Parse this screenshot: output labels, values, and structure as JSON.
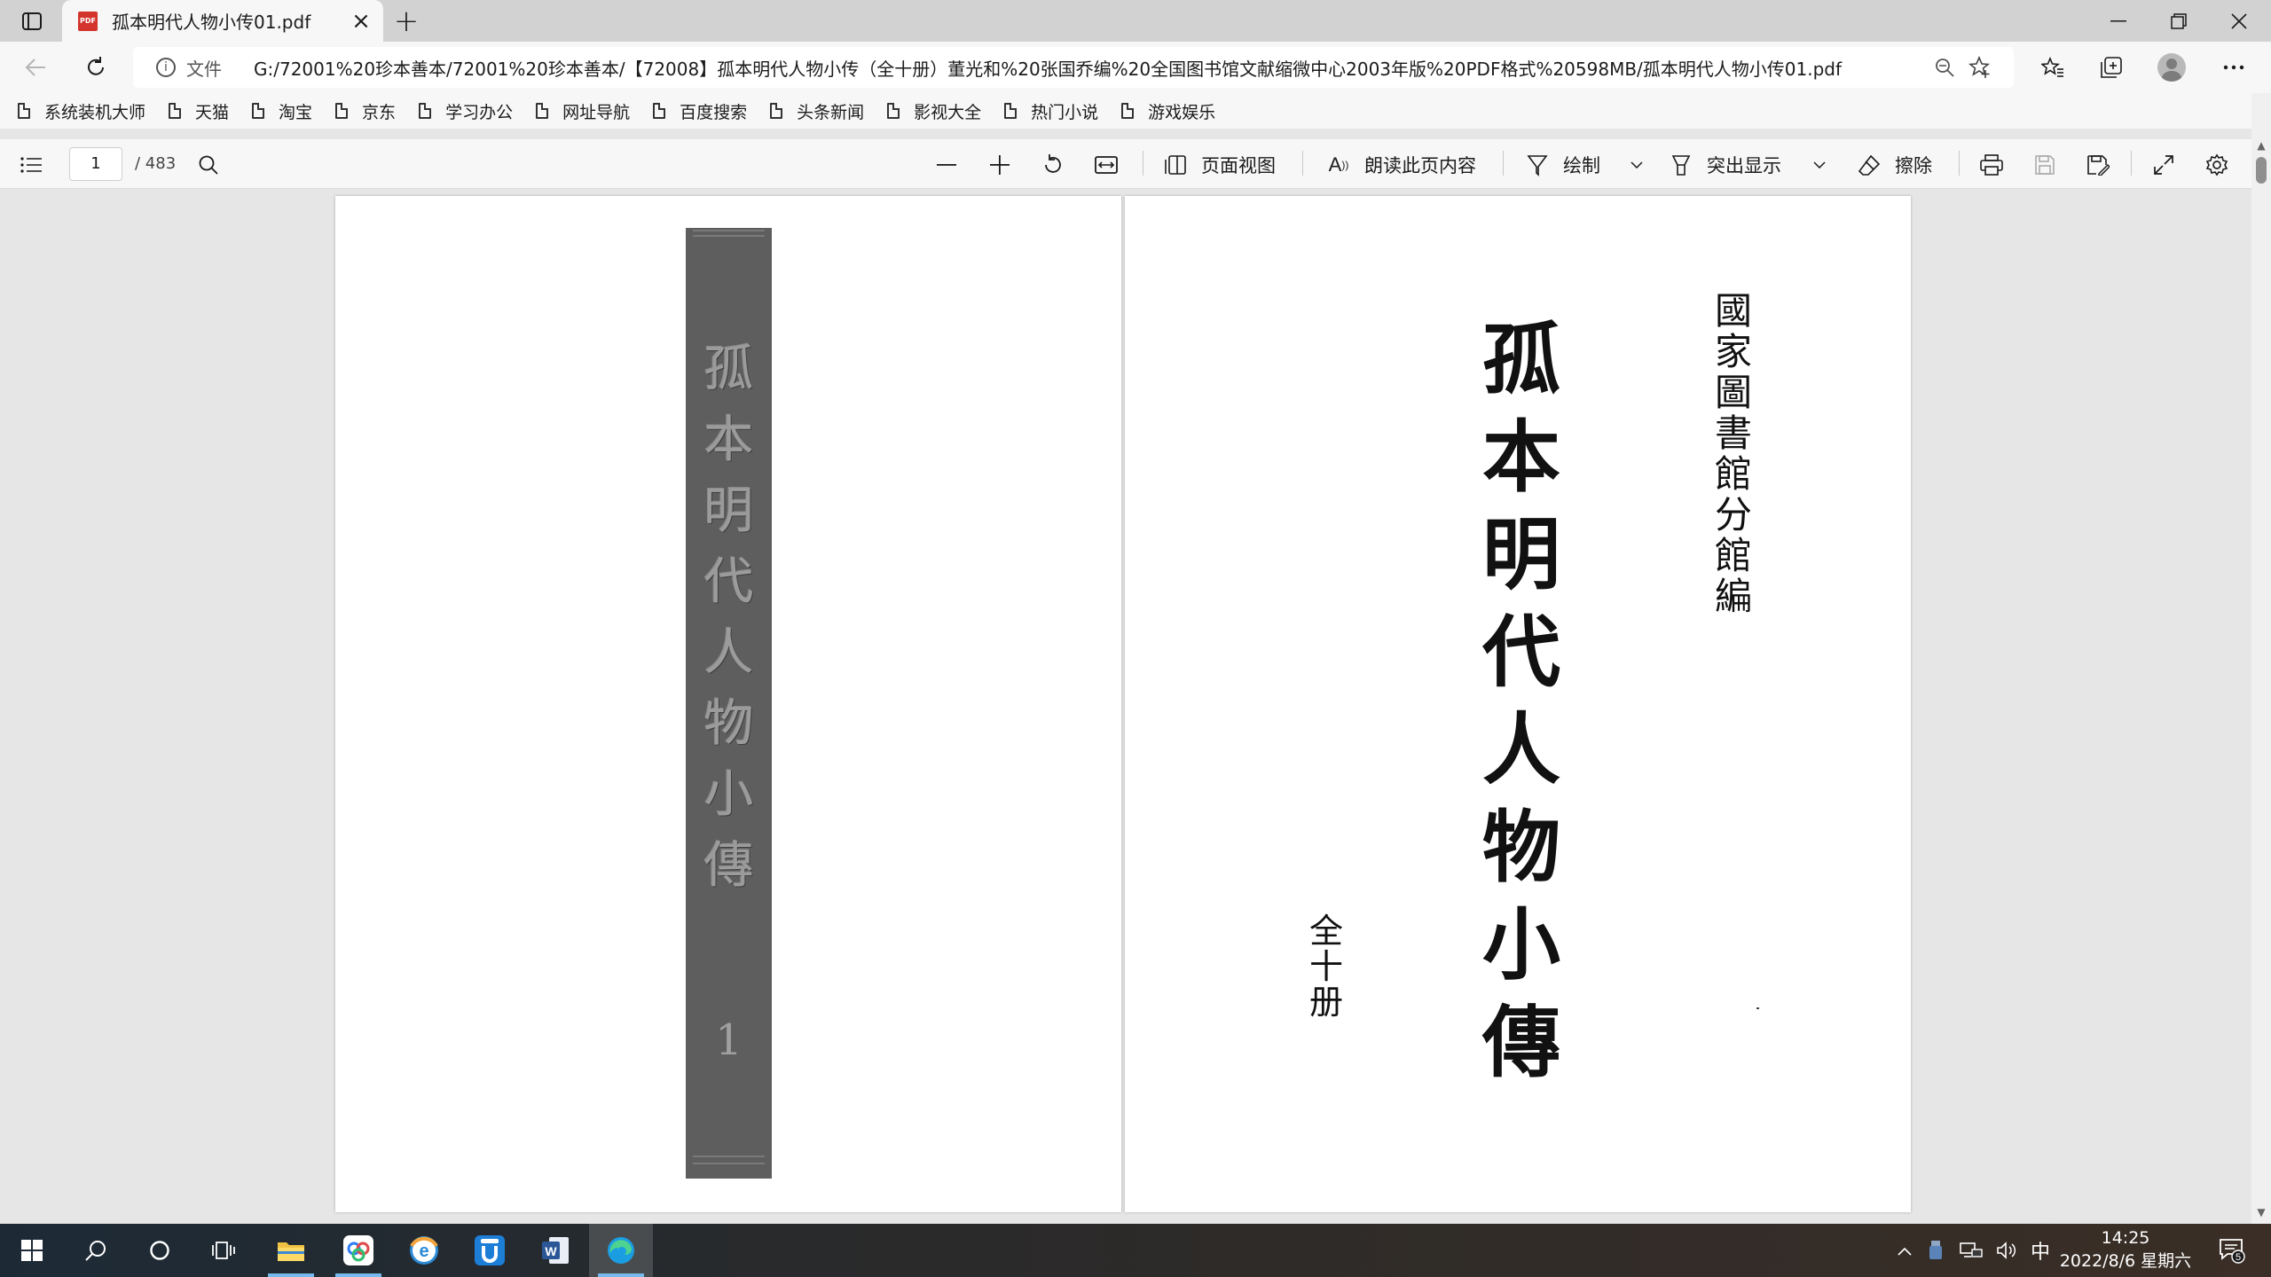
{
  "browser": {
    "tab_title": "孤本明代人物小传01.pdf",
    "tab_favicon_text": "PDF",
    "address": {
      "scheme_label": "文件",
      "url": "G:/72001%20珍本善本/72001%20珍本善本/【72008】孤本明代人物小传（全十册）董光和%20张国乔编%20全国图书馆文献缩微中心2003年版%20PDF格式%20598MB/孤本明代人物小传01.pdf"
    },
    "bookmarks": [
      "系统装机大师",
      "天猫",
      "淘宝",
      "京东",
      "学习办公",
      "网址导航",
      "百度搜索",
      "头条新闻",
      "影视大全",
      "热门小说",
      "游戏娱乐"
    ]
  },
  "pdf_toolbar": {
    "page_number": "1",
    "page_total": "/ 483",
    "page_view_label": "页面视图",
    "read_aloud_label": "朗读此页内容",
    "draw_label": "绘制",
    "highlight_label": "突出显示",
    "erase_label": "擦除"
  },
  "document": {
    "spine_title": [
      "孤",
      "本",
      "明",
      "代",
      "人",
      "物",
      "小",
      "傳"
    ],
    "spine_volume": "1",
    "cover_title": [
      "孤",
      "本",
      "明",
      "代",
      "人",
      "物",
      "小",
      "傳"
    ],
    "cover_publisher": [
      "國",
      "家",
      "圖",
      "書",
      "館",
      "分",
      "館",
      "編"
    ],
    "cover_volumes": [
      "全",
      "十",
      "册"
    ]
  },
  "taskbar": {
    "ime_label": "中",
    "time": "14:25",
    "date": "2022/8/6 星期六",
    "notification_count": "5"
  },
  "colors": {
    "accent_underline": "#76b9ed",
    "spine": "#5e5e5e",
    "pdf_favicon": "#d3352c"
  }
}
